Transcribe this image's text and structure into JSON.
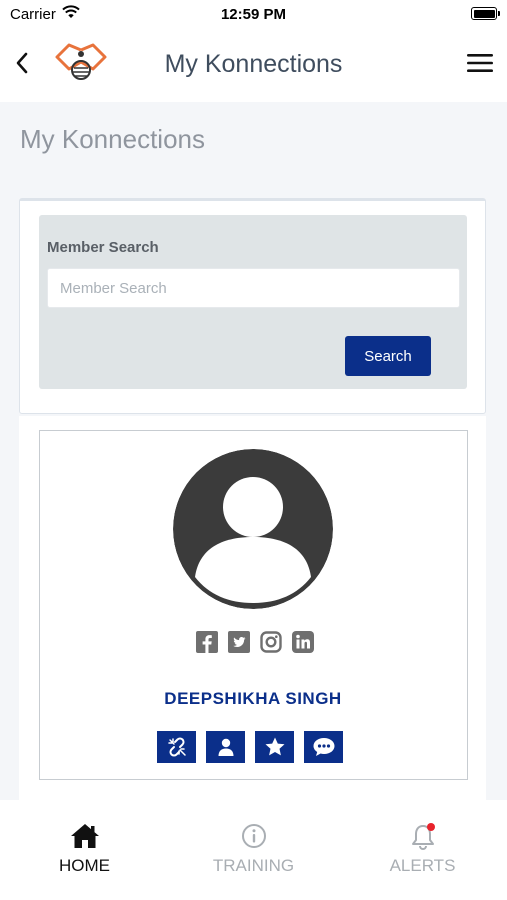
{
  "status_bar": {
    "carrier": "Carrier",
    "time": "12:59 PM"
  },
  "header": {
    "title": "My Konnections"
  },
  "page": {
    "title": "My Konnections"
  },
  "search": {
    "label": "Member Search",
    "placeholder": "Member Search",
    "value": "",
    "button_label": "Search"
  },
  "member": {
    "name": "DEEPSHIKHA SINGH",
    "social_icons": [
      "facebook-icon",
      "twitter-icon",
      "instagram-icon",
      "linkedin-icon"
    ],
    "action_icons": [
      "unlink-icon",
      "profile-icon",
      "star-icon",
      "chat-icon"
    ]
  },
  "tabbar": {
    "tabs": [
      {
        "label": "HOME",
        "icon": "home-icon",
        "active": true
      },
      {
        "label": "TRAINING",
        "icon": "info-icon",
        "active": false
      },
      {
        "label": "ALERTS",
        "icon": "bell-icon",
        "active": false,
        "badge": true
      }
    ]
  },
  "colors": {
    "brand_blue": "#0b2f8a",
    "header_text": "#3f4d5e",
    "logo_orange": "#e8733c",
    "alert_badge": "#e8232c",
    "page_background": "#f4f6f9"
  }
}
